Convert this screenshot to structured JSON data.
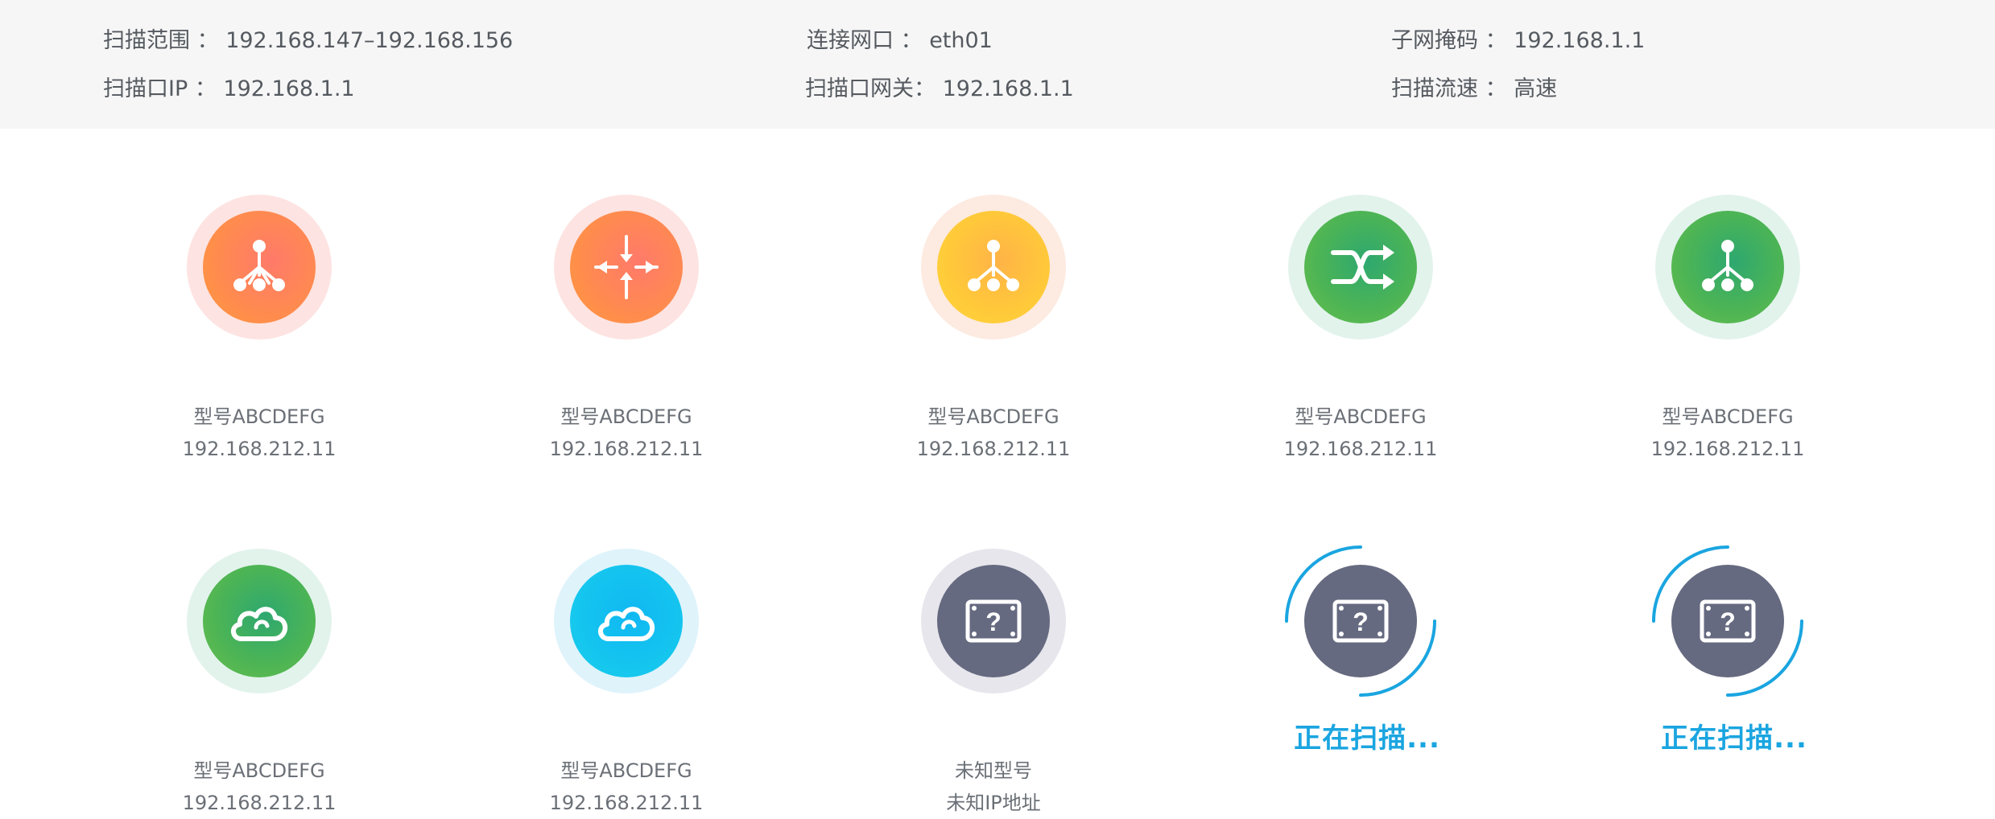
{
  "header": {
    "scan_range_label": "扫描范围 ：",
    "scan_range_value": "192.168.147–192.168.156",
    "scan_port_ip_label": "扫描口IP ：",
    "scan_port_ip_value": "192.168.1.1",
    "link_port_label": "连接网口 ：",
    "link_port_value": "eth01",
    "gateway_label": "扫描口网关：",
    "gateway_value": "192.168.1.1",
    "subnet_label": "子网掩码 ：",
    "subnet_value": "192.168.1.1",
    "speed_label": "扫描流速 ：",
    "speed_value": "高速"
  },
  "colors": {
    "orange": "#ff8a50",
    "yellow": "#ffc83a",
    "green": "#4cb455",
    "cyan": "#14c4ef",
    "gray": "#666a80",
    "scan_blue": "#1aa5e0"
  },
  "devices": [
    {
      "icon": "network-tree-icon",
      "model": "型号ABCDEFG",
      "ip": "192.168.212.11"
    },
    {
      "icon": "arrows-converge-icon",
      "model": "型号ABCDEFG",
      "ip": "192.168.212.11"
    },
    {
      "icon": "network-tree-icon",
      "model": "型号ABCDEFG",
      "ip": "192.168.212.11"
    },
    {
      "icon": "shuffle-icon",
      "model": "型号ABCDEFG",
      "ip": "192.168.212.11"
    },
    {
      "icon": "network-tree-icon",
      "model": "型号ABCDEFG",
      "ip": "192.168.212.11"
    },
    {
      "icon": "cloud-icon",
      "model": "型号ABCDEFG",
      "ip": "192.168.212.11"
    },
    {
      "icon": "cloud-icon",
      "model": "型号ABCDEFG",
      "ip": "192.168.212.11"
    },
    {
      "icon": "unknown-device-icon",
      "model": "未知型号",
      "ip": "未知IP地址"
    },
    {
      "icon": "unknown-device-icon",
      "status": "正在扫描..."
    },
    {
      "icon": "unknown-device-icon",
      "status": "正在扫描..."
    }
  ]
}
